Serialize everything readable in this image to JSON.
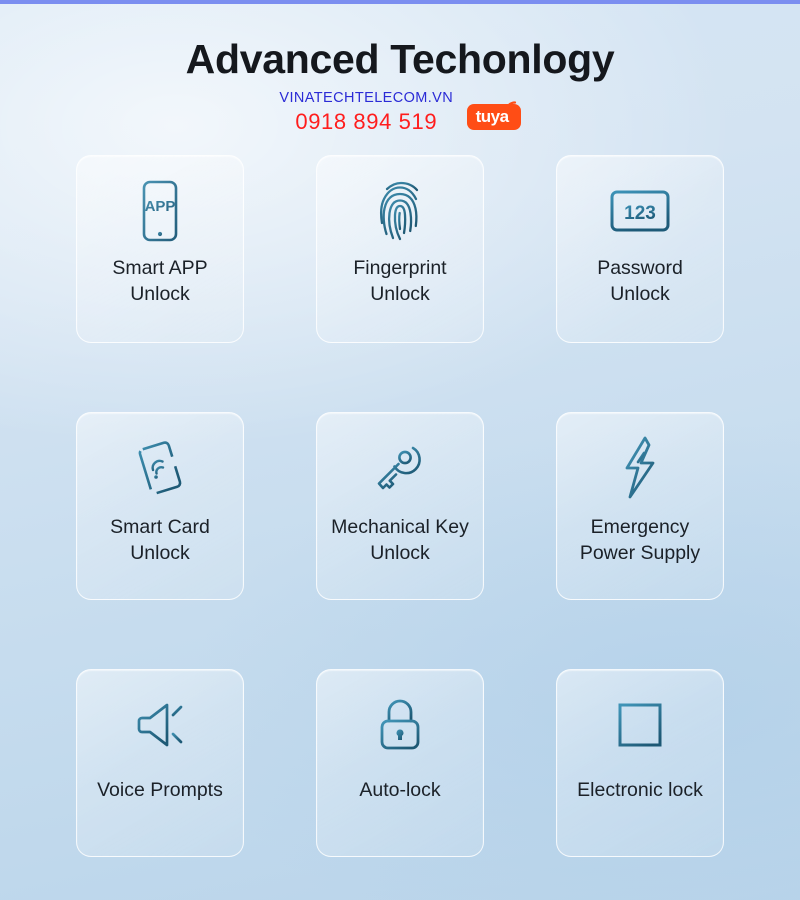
{
  "header": {
    "title": "Advanced Techonlogy",
    "website": "VINATECHTELECOM.VN",
    "phone": "0918 894 519",
    "brand_logo_text": "tuya",
    "brand_logo_color": "#ff4d15",
    "website_color": "#2b2bd6",
    "phone_color": "#ff1d1d",
    "title_color": "#15181d"
  },
  "theme": {
    "top_accent_color": "#7b8ef0",
    "background_from": "#d6e6f4",
    "background_to": "#b9d4ea",
    "icon_color": "#2d7392",
    "label_color": "#1b2128"
  },
  "features": [
    {
      "icon": "smartphone-app-icon",
      "icon_text": "APP",
      "label": "Smart APP\nUnlock"
    },
    {
      "icon": "fingerprint-icon",
      "icon_text": "",
      "label": "Fingerprint\nUnlock"
    },
    {
      "icon": "password-123-icon",
      "icon_text": "123",
      "label": "Password\nUnlock"
    },
    {
      "icon": "smart-card-nfc-icon",
      "icon_text": "",
      "label": "Smart Card\nUnlock"
    },
    {
      "icon": "mechanical-key-icon",
      "icon_text": "",
      "label": "Mechanical Key\nUnlock"
    },
    {
      "icon": "lightning-bolt-icon",
      "icon_text": "",
      "label": "Emergency\nPower Supply"
    },
    {
      "icon": "megaphone-icon",
      "icon_text": "",
      "label": "Voice Prompts"
    },
    {
      "icon": "padlock-icon",
      "icon_text": "",
      "label": "Auto-lock"
    },
    {
      "icon": "electronic-lock-icon",
      "icon_text": "",
      "label": "Electronic lock"
    }
  ]
}
